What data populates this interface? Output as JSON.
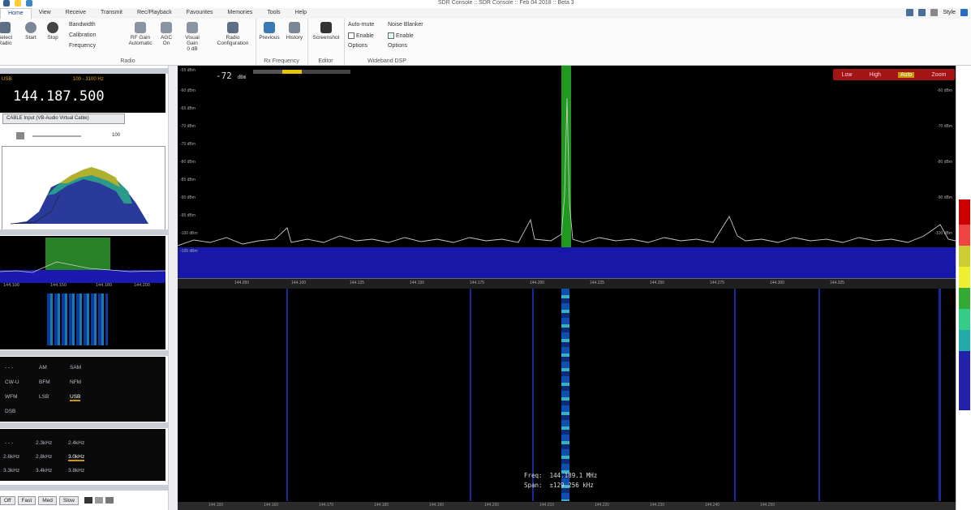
{
  "title": "SDR Console :: SDR Console :: Feb 04 2018 :: Beta 3",
  "tabs": [
    "Home",
    "View",
    "Receive",
    "Transmit",
    "Rec/Playback",
    "Favourites",
    "Memories",
    "Tools",
    "Help"
  ],
  "style_label": "Style",
  "ribbon": {
    "select": "Select Radio",
    "start": "Start",
    "stop": "Stop",
    "bandwidth": "Bandwidth",
    "calibration": "Calibration",
    "frequency": "Frequency",
    "rf_gain": "RF Gain",
    "rf_gain_val": "Automatic",
    "agc": "AGC",
    "agc_val": "On",
    "visual_gain": "Visual Gain",
    "visual_gain_val": "0 dB",
    "radio_config": "Radio Configuration",
    "group_radio": "Radio",
    "previous": "Previous",
    "history": "History",
    "group_rx": "Rx Frequency",
    "screenshot": "Screenshot",
    "group_editor": "Editor",
    "automute": "Auto-mute",
    "noise_blanker": "Noise Blanker",
    "enable": "Enable",
    "options": "Options",
    "group_dsp": "Wideband DSP"
  },
  "receiver": {
    "frequency": "144.187.500",
    "mode": "USB",
    "bw": "100 - 3100 Hz",
    "input": "CABLE Input (VB-Audio Virtual Cable)",
    "vol": "100"
  },
  "modes": [
    "AM",
    "SAM",
    "CW-U",
    "BFM",
    "NFM",
    "WFM",
    "LSB",
    "USB",
    "DSB"
  ],
  "filters": [
    "2.3kHz",
    "2.4kHz",
    "2.6kHz",
    "2.8kHz",
    "3.0kHz",
    "3.3kHz",
    "3.4kHz",
    "3.8kHz"
  ],
  "agc_buttons": [
    "Off",
    "Fast",
    "Med",
    "Slow"
  ],
  "mini_axis": [
    "144.100",
    "144.150",
    "144.180",
    "144.200"
  ],
  "spectrum": {
    "level": "-72",
    "level_unit": "dBm",
    "zoom": [
      "Low",
      "High",
      "Auto",
      "Zoom"
    ],
    "db_labels": [
      "-55 dBm",
      "-60 dBm",
      "-65 dBm",
      "-70 dBm",
      "-75 dBm",
      "-80 dBm",
      "-85 dBm",
      "-90 dBm",
      "-95 dBm",
      "-100 dBm",
      "-105 dBm"
    ],
    "axis": [
      "144.050",
      "144.100",
      "144.125",
      "144.150",
      "144.175",
      "144.200",
      "144.225",
      "144.250",
      "144.275",
      "144.300",
      "144.325"
    ],
    "bottom_axis": [
      "144.150",
      "144.160",
      "144.170",
      "144.180",
      "144.190",
      "144.200",
      "144.210",
      "144.220",
      "144.230",
      "144.240",
      "144.250"
    ]
  },
  "readout": {
    "freq": "Freq:  144.189.1 MHz",
    "span": "Span:  ±129.256 kHz"
  },
  "colors": {
    "accent": "#a31515",
    "spectrum_fill": "#1a1ab0",
    "signal": "#2a9a2a"
  }
}
